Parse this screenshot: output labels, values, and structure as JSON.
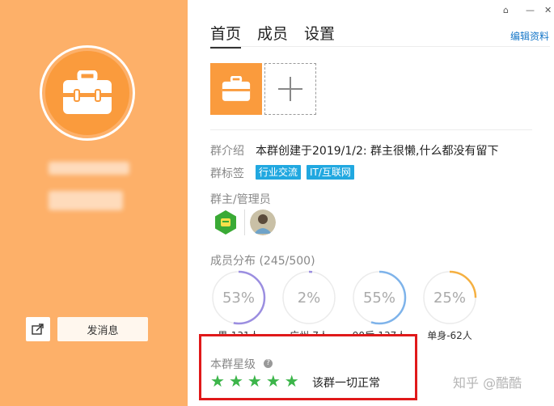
{
  "window": {
    "pin_glyph": "⌂",
    "minimize_glyph": "—",
    "close_glyph": "✕"
  },
  "tabs": [
    {
      "label": "首页",
      "active": true
    },
    {
      "label": "成员",
      "active": false
    },
    {
      "label": "设置",
      "active": false
    }
  ],
  "edit_profile_label": "编辑资料",
  "left_panel": {
    "message_button_label": "发消息",
    "share_icon": "share-icon",
    "brand_color": "#fdb069"
  },
  "photos": {
    "add_glyph": "+"
  },
  "group_intro": {
    "label": "群介绍",
    "text": "本群创建于2019/1/2:  群主很懒,什么都没有留下"
  },
  "group_tags": {
    "label": "群标签",
    "tags": [
      "行业交流",
      "IT/互联网"
    ]
  },
  "admins": {
    "label": "群主/管理员"
  },
  "member_stats": {
    "label": "成员分布 (245/500)",
    "rings": [
      {
        "percent_text": "53%",
        "value": 53,
        "color": "#9b8ee0",
        "caption": "男-131人"
      },
      {
        "percent_text": "2%",
        "value": 2,
        "color": "#9b8ee0",
        "caption": "广州-7人"
      },
      {
        "percent_text": "55%",
        "value": 55,
        "color": "#7eb3ea",
        "caption": "90后-137人"
      },
      {
        "percent_text": "25%",
        "value": 25,
        "color": "#f5b041",
        "caption": "单身-62人"
      }
    ]
  },
  "rating": {
    "label": "本群星级",
    "help_glyph": "?",
    "star_glyph": "★",
    "stars": 5,
    "text": "该群一切正常"
  },
  "watermark": "知乎 @酷酷"
}
